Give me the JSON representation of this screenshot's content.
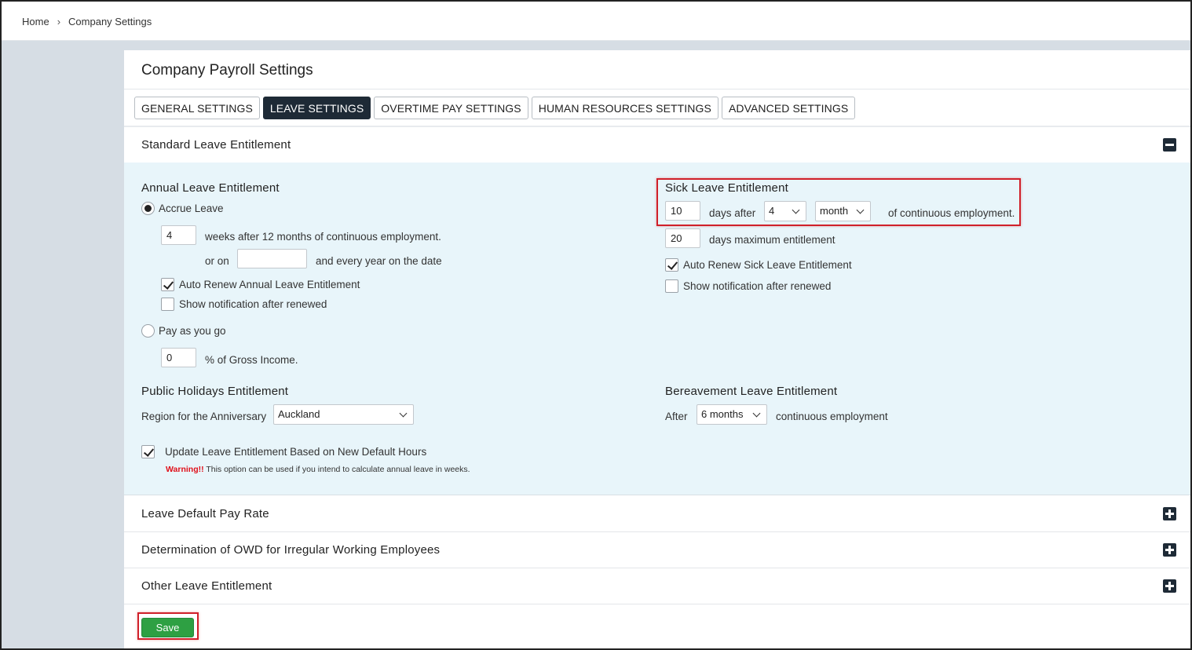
{
  "breadcrumb": {
    "home": "Home",
    "separator": "›",
    "current": "Company Settings"
  },
  "page": {
    "title": "Company Payroll Settings"
  },
  "tabs": [
    {
      "label": "GENERAL SETTINGS",
      "active": false
    },
    {
      "label": "LEAVE SETTINGS",
      "active": true
    },
    {
      "label": "OVERTIME PAY SETTINGS",
      "active": false
    },
    {
      "label": "HUMAN RESOURCES SETTINGS",
      "active": false
    },
    {
      "label": "ADVANCED SETTINGS",
      "active": false
    }
  ],
  "standard": {
    "header": "Standard Leave Entitlement",
    "toggle": "minus-icon",
    "annual": {
      "heading": "Annual Leave Entitlement",
      "accrue_label": "Accrue Leave",
      "accrue_selected": true,
      "weeks_value": "4",
      "weeks_text": "weeks after 12 months of continuous employment.",
      "or_on_label": "or on",
      "date_value": "",
      "date_suffix": "and every year on the date",
      "auto_renew_label": "Auto Renew Annual Leave Entitlement",
      "auto_renew_checked": true,
      "notify_label": "Show notification after renewed",
      "notify_checked": false,
      "payg_label": "Pay as you go",
      "payg_selected": false,
      "gross_value": "0",
      "gross_text": "% of Gross Income."
    },
    "sick": {
      "heading": "Sick Leave Entitlement",
      "days_value": "10",
      "days_after_label": "days after",
      "period_count": "4",
      "period_unit": "month",
      "suffix": "of continuous employment.",
      "max_value": "20",
      "max_label": "days maximum entitlement",
      "auto_renew_label": "Auto Renew Sick Leave Entitlement",
      "auto_renew_checked": true,
      "notify_label": "Show notification after renewed",
      "notify_checked": false
    },
    "public_holidays": {
      "heading": "Public Holidays Entitlement",
      "region_label": "Region for the Anniversary",
      "region_value": "Auckland"
    },
    "bereavement": {
      "heading": "Bereavement Leave Entitlement",
      "after_label": "After",
      "period_value": "6 months",
      "suffix": "continuous employment"
    },
    "update": {
      "label": "Update Leave Entitlement Based on New Default Hours",
      "checked": true,
      "warning_strong": "Warning!!",
      "warning_text": "This option can be used if you intend to calculate annual leave in weeks."
    }
  },
  "collapsed_sections": [
    {
      "label": "Leave Default Pay Rate",
      "toggle": "plus-icon"
    },
    {
      "label": "Determination of OWD for Irregular Working Employees",
      "toggle": "plus-icon"
    },
    {
      "label": "Other Leave Entitlement",
      "toggle": "plus-icon"
    }
  ],
  "actions": {
    "save_label": "Save"
  },
  "colors": {
    "accent_dark": "#1e2a36",
    "save_green": "#2ea043",
    "highlight_red": "#d0202a",
    "body_bg": "#e8f5fa",
    "warning_red": "#e0101a"
  }
}
